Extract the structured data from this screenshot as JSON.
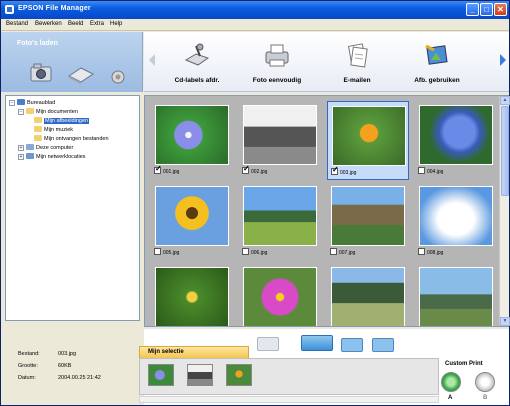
{
  "window": {
    "title": "EPSON File Manager"
  },
  "menu": [
    "Bestand",
    "Bewerken",
    "Beeld",
    "Extra",
    "Help"
  ],
  "left_panel": {
    "section_title": "Foto's laden"
  },
  "toolbar": {
    "items": [
      {
        "label": "Cd-labels afdr.",
        "icon": "cd-label-icon"
      },
      {
        "label": "Foto eenvoudig",
        "icon": "printer-icon"
      },
      {
        "label": "E-mailen",
        "icon": "email-icon"
      },
      {
        "label": "Afb. gebruiken",
        "icon": "image-use-icon"
      }
    ]
  },
  "tree": {
    "items": [
      {
        "label": "Bureaublad",
        "level": 0,
        "expander": "−"
      },
      {
        "label": "Mijn documenten",
        "level": 1,
        "expander": "−"
      },
      {
        "label": "Mijn afbeeldingen",
        "level": 2,
        "selected": true
      },
      {
        "label": "Mijn muziek",
        "level": 2
      },
      {
        "label": "Mijn ontvangen bestanden",
        "level": 2
      },
      {
        "label": "Deze computer",
        "level": 1,
        "expander": "+"
      },
      {
        "label": "Mijn netwerklocaties",
        "level": 1,
        "expander": "+"
      }
    ]
  },
  "thumbnails": [
    {
      "name": "001.jpg",
      "checked": true,
      "selected": false,
      "subject": "blue-morning-glory"
    },
    {
      "name": "002.jpg",
      "checked": true,
      "selected": false,
      "subject": "steam-locomotive"
    },
    {
      "name": "003.jpg",
      "checked": true,
      "selected": true,
      "subject": "orange-lily"
    },
    {
      "name": "004.jpg",
      "checked": false,
      "selected": false,
      "subject": "hydrangea"
    },
    {
      "name": "005.jpg",
      "checked": false,
      "selected": false,
      "subject": "sunflower"
    },
    {
      "name": "006.jpg",
      "checked": false,
      "selected": false,
      "subject": "landscape"
    },
    {
      "name": "007.jpg",
      "checked": false,
      "selected": false,
      "subject": "rocky-landscape"
    },
    {
      "name": "008.jpg",
      "checked": false,
      "selected": false,
      "subject": "clouds"
    },
    {
      "name": "",
      "checked": false,
      "selected": false,
      "subject": "yellow-flower"
    },
    {
      "name": "",
      "checked": false,
      "selected": false,
      "subject": "cosmos-flower"
    },
    {
      "name": "",
      "checked": false,
      "selected": false,
      "subject": "field"
    },
    {
      "name": "",
      "checked": false,
      "selected": false,
      "subject": "mountains"
    }
  ],
  "file_info": {
    "rows": [
      {
        "key": "Bestand:",
        "value": "003.jpg"
      },
      {
        "key": "Grootte:",
        "value": "60KB"
      },
      {
        "key": "Datum:",
        "value": "2004.00.25 21:42"
      }
    ]
  },
  "selection": {
    "tab_label": "Mijn selectie"
  },
  "custom_print": {
    "label": "Custom Print",
    "buttons": [
      "A",
      "B"
    ]
  }
}
